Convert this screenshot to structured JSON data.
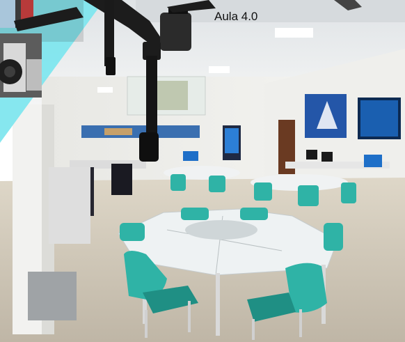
{
  "caption": {
    "text": "Aula 4.0"
  },
  "colors": {
    "chair": "#2fb3a6",
    "chair_dark": "#1f8f84",
    "table_top": "#eef2f3",
    "floor": "#cfc7b8",
    "ceiling": "#e9ecee",
    "wall": "#f1f1ee",
    "drone_arm": "#1c1c1c",
    "cyan_triangle": "#7fe6ee",
    "tv_screen": "#1a5fb0",
    "door": "#6a3a22"
  },
  "icons": [
    "drone-icon"
  ]
}
